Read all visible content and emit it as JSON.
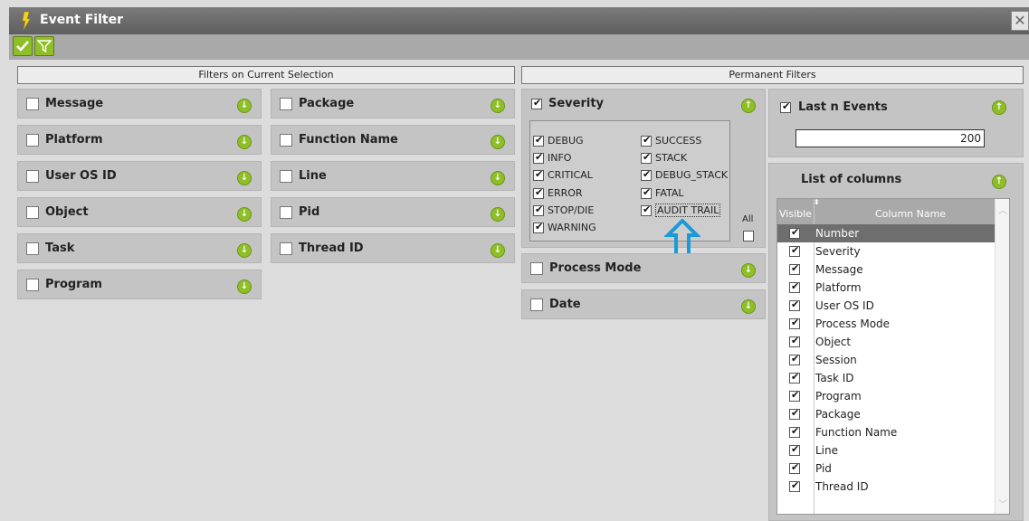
{
  "window": {
    "title": "Event Filter",
    "close_glyph": "✕"
  },
  "toolbar": {
    "apply_icon": "check-icon",
    "filter_icon": "funnel-icon"
  },
  "sections": {
    "current": "Filters on Current Selection",
    "permanent": "Permanent Filters"
  },
  "filters_left": [
    "Message",
    "Platform",
    "User OS ID",
    "Object",
    "Task",
    "Program"
  ],
  "filters_middle": [
    "Package",
    "Function Name",
    "Line",
    "Pid",
    "Thread ID"
  ],
  "severity": {
    "label": "Severity",
    "checked": true,
    "items_col1": [
      "DEBUG",
      "INFO",
      "CRITICAL",
      "ERROR",
      "STOP/DIE",
      "WARNING"
    ],
    "items_col2": [
      "SUCCESS",
      "STACK",
      "DEBUG_STACK",
      "FATAL",
      "AUDIT TRAIL"
    ],
    "all_label": "All"
  },
  "process_mode": {
    "label": "Process Mode"
  },
  "date": {
    "label": "Date"
  },
  "last_n": {
    "label": "Last n Events",
    "checked": true,
    "value": "200"
  },
  "columns": {
    "label": "List of columns",
    "header_visible": "Visible",
    "header_name": "Column Name",
    "rows": [
      "Number",
      "Severity",
      "Message",
      "Platform",
      "User OS ID",
      "Process Mode",
      "Object",
      "Session",
      "Task ID",
      "Program",
      "Package",
      "Function Name",
      "Line",
      "Pid",
      "Thread ID"
    ]
  },
  "colors": {
    "accent_green": "#8fbf27",
    "highlight_arrow": "#1a9ad6",
    "selected_row": "#6e6e6e"
  }
}
